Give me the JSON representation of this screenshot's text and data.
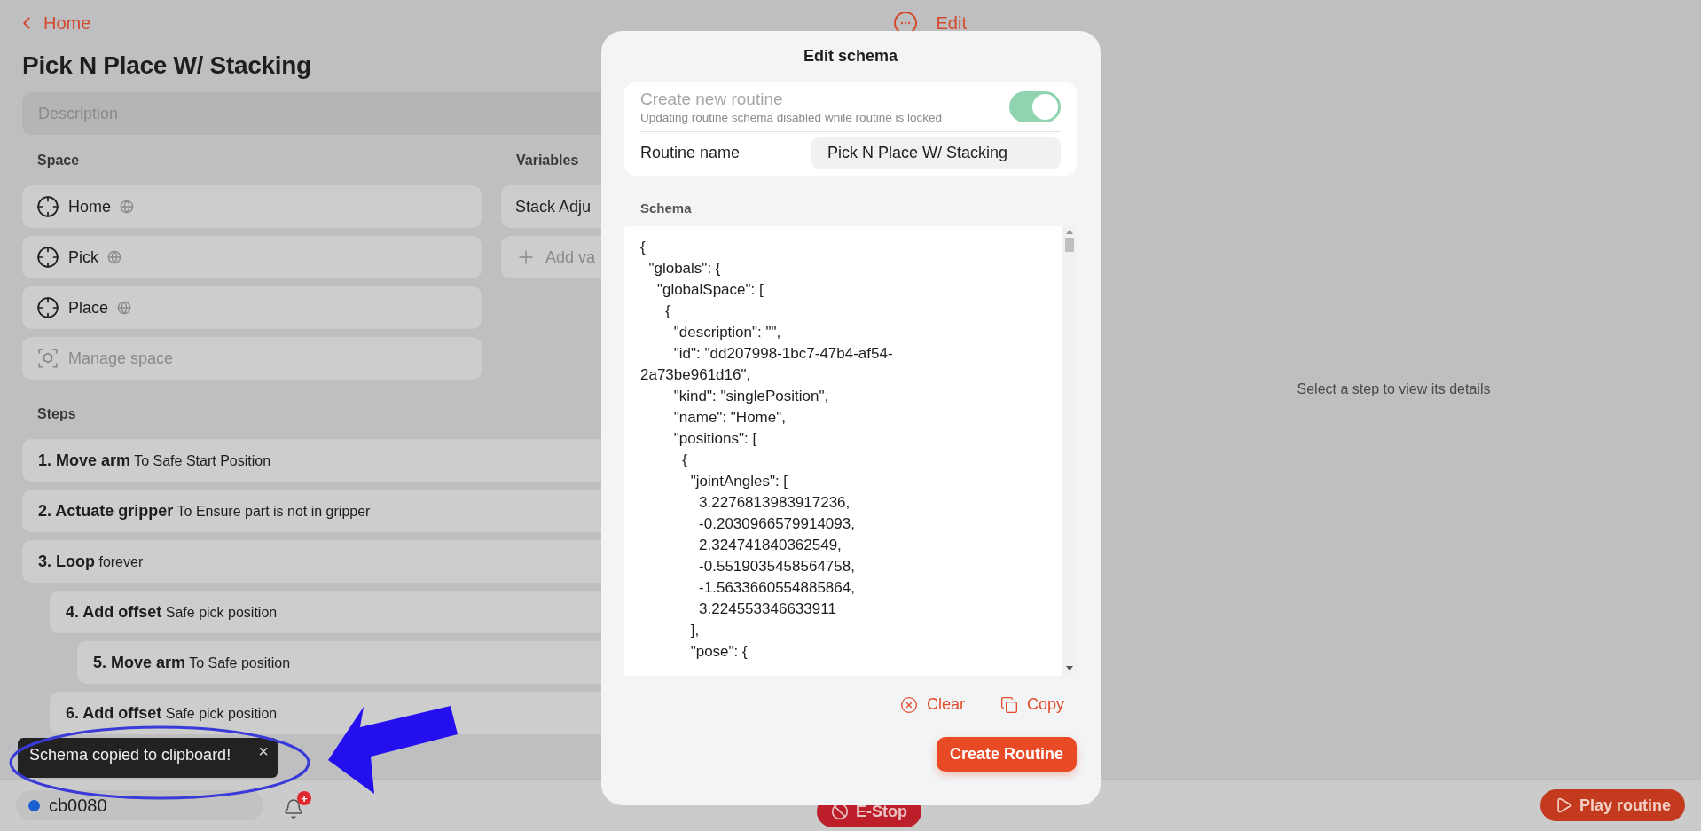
{
  "header": {
    "back_link": "Home",
    "edit_button": "Edit",
    "title": "Pick N Place W/ Stacking",
    "description": {
      "placeholder": "Description"
    }
  },
  "space": {
    "heading": "Space",
    "items": [
      {
        "kind": "position",
        "label": "Home"
      },
      {
        "kind": "position",
        "label": "Pick"
      },
      {
        "kind": "position",
        "label": "Place"
      },
      {
        "kind": "manage",
        "label": "Manage space"
      }
    ]
  },
  "variables": {
    "heading": "Variables",
    "items": [
      {
        "kind": "variable",
        "label": "Stack Adju"
      },
      {
        "kind": "add",
        "label": "Add va"
      }
    ]
  },
  "steps": {
    "heading": "Steps",
    "items": [
      {
        "text": "**1. Move arm** To Safe Start Position"
      },
      {
        "text": "**2. Actuate gripper** To Ensure part is not in gripper"
      },
      {
        "text": "**3. Loop** forever",
        "children": [
          {
            "text": "**4. Add offset** Safe pick position",
            "children": [
              {
                "text": "**5. Move arm**  To Safe position"
              }
            ]
          },
          {
            "text": "**6. Add offset** Safe pick position"
          }
        ]
      }
    ]
  },
  "details_hint": "Select a step to view its details",
  "status": {
    "robot": "cb0080",
    "color": "#1a5fd0",
    "notifications_badge": "+",
    "estop": "E-Stop",
    "play": "Play routine"
  },
  "toast": {
    "message": "Schema copied to clipboard!",
    "close": "×"
  },
  "modal": {
    "title": "Edit schema",
    "create_new_routine": {
      "label": "Create new routine",
      "hint": "Updating routine schema disabled while routine is locked",
      "on": true,
      "disabled": true
    },
    "routine_name": {
      "label": "Routine name",
      "value": "Pick N Place W/ Stacking"
    },
    "schema_label": "Schema",
    "schema_lines": [
      "{",
      "  \"globals\": {",
      "    \"globalSpace\": [",
      "      {",
      "        \"description\": \"\",",
      "        \"id\": \"dd207998-1bc7-47b4-af54-",
      "2a73be961d16\",",
      "        \"kind\": \"singlePosition\",",
      "        \"name\": \"Home\",",
      "        \"positions\": [",
      "          {",
      "            \"jointAngles\": [",
      "              3.2276813983917236,",
      "              -0.2030966579914093,",
      "              2.324741840362549,",
      "              -0.5519035458564758,",
      "              -1.5633660554885864,",
      "              3.224553346633911",
      "            ],",
      "            \"pose\": {"
    ],
    "clear": "Clear",
    "copy": "Copy",
    "create": "Create Routine"
  }
}
